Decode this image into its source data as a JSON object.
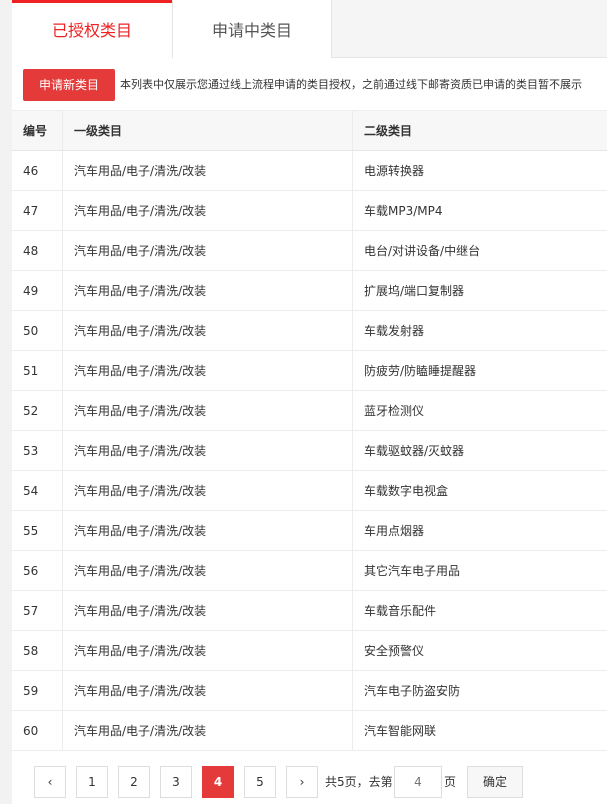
{
  "tabs": {
    "active": "已授权类目",
    "inactive": "申请中类目"
  },
  "notice": {
    "apply_button": "申请新类目",
    "text": "本列表中仅展示您通过线上流程申请的类目授权，之前通过线下邮寄资质已申请的类目暂不展示"
  },
  "table": {
    "headers": {
      "no": "编号",
      "category1": "一级类目",
      "category2": "二级类目"
    },
    "rows": [
      {
        "no": "46",
        "c1": "汽车用品/电子/清洗/改装",
        "c2": "电源转换器"
      },
      {
        "no": "47",
        "c1": "汽车用品/电子/清洗/改装",
        "c2": "车载MP3/MP4"
      },
      {
        "no": "48",
        "c1": "汽车用品/电子/清洗/改装",
        "c2": "电台/对讲设备/中继台"
      },
      {
        "no": "49",
        "c1": "汽车用品/电子/清洗/改装",
        "c2": "扩展坞/端口复制器"
      },
      {
        "no": "50",
        "c1": "汽车用品/电子/清洗/改装",
        "c2": "车载发射器"
      },
      {
        "no": "51",
        "c1": "汽车用品/电子/清洗/改装",
        "c2": "防疲劳/防瞌睡提醒器"
      },
      {
        "no": "52",
        "c1": "汽车用品/电子/清洗/改装",
        "c2": "蓝牙检测仪"
      },
      {
        "no": "53",
        "c1": "汽车用品/电子/清洗/改装",
        "c2": "车载驱蚊器/灭蚊器"
      },
      {
        "no": "54",
        "c1": "汽车用品/电子/清洗/改装",
        "c2": "车载数字电视盒"
      },
      {
        "no": "55",
        "c1": "汽车用品/电子/清洗/改装",
        "c2": "车用点烟器"
      },
      {
        "no": "56",
        "c1": "汽车用品/电子/清洗/改装",
        "c2": "其它汽车电子用品"
      },
      {
        "no": "57",
        "c1": "汽车用品/电子/清洗/改装",
        "c2": "车载音乐配件"
      },
      {
        "no": "58",
        "c1": "汽车用品/电子/清洗/改装",
        "c2": "安全预警仪"
      },
      {
        "no": "59",
        "c1": "汽车用品/电子/清洗/改装",
        "c2": "汽车电子防盗安防"
      },
      {
        "no": "60",
        "c1": "汽车用品/电子/清洗/改装",
        "c2": "汽车智能网联"
      }
    ]
  },
  "pagination": {
    "prev_icon": "chevron-left-icon",
    "next_icon": "chevron-right-icon",
    "prev_glyph": "‹",
    "next_glyph": "›",
    "pages": [
      "1",
      "2",
      "3",
      "4",
      "5"
    ],
    "current": "4",
    "total_text": "共5页，去第",
    "input_placeholder": "4",
    "page_suffix": "页",
    "confirm_label": "确定"
  },
  "colors": {
    "accent": "#e43a3a",
    "tab_active_text": "#e22"
  }
}
